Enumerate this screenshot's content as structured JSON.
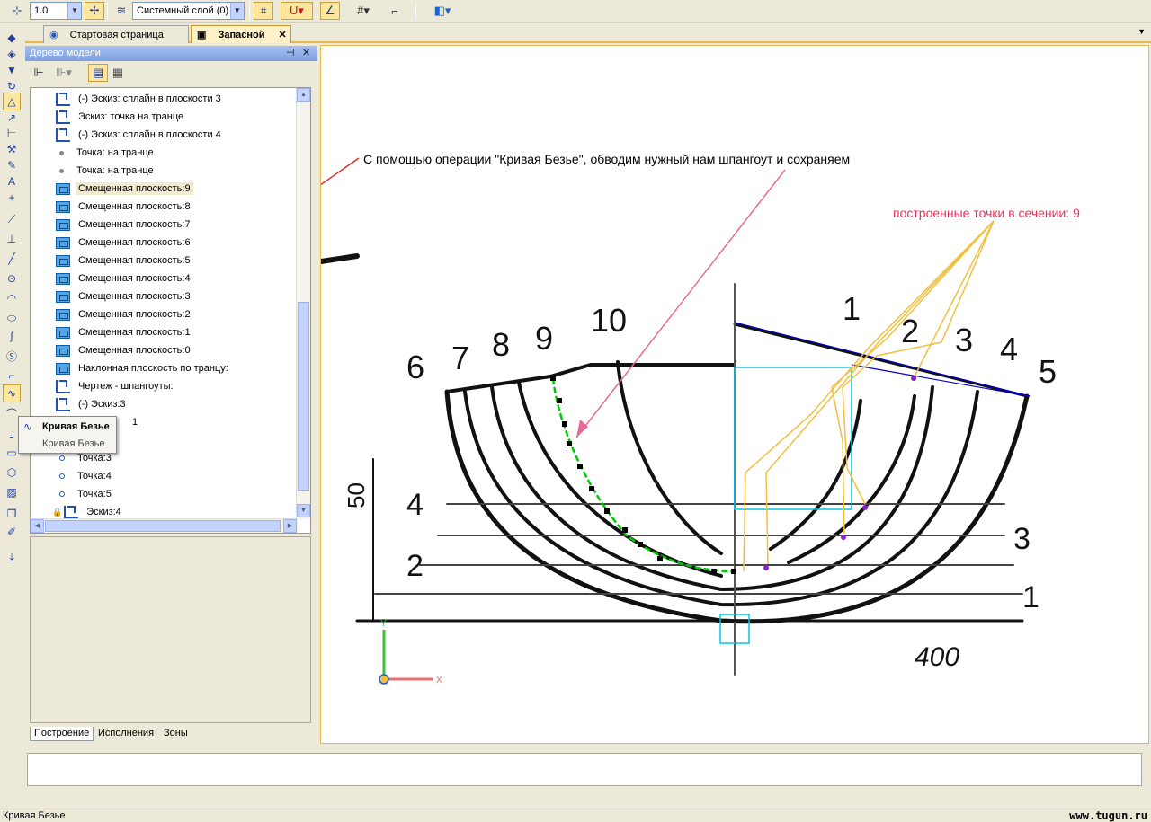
{
  "toolbar": {
    "scale_value": "1.0",
    "layer_value": "Системный слой (0)"
  },
  "tabs": [
    {
      "label": "Стартовая страница"
    },
    {
      "label": "Запасной"
    }
  ],
  "tree": {
    "title": "Дерево модели",
    "rows": [
      {
        "label": "(-) Эскиз: сплайн в плоскости 3",
        "icon": "sketch-icon"
      },
      {
        "label": "Эскиз: точка на транце",
        "icon": "sketch-icon"
      },
      {
        "label": "(-) Эскиз: сплайн  в плоскости 4",
        "icon": "sketch-icon"
      },
      {
        "label": "Точка: на транце",
        "icon": "point-icon"
      },
      {
        "label": "Точка: на транце",
        "icon": "point-icon"
      },
      {
        "label": "Смещенная плоскость:9",
        "icon": "plane-icon",
        "selected": true
      },
      {
        "label": "Смещенная плоскость:8",
        "icon": "plane-icon"
      },
      {
        "label": "Смещенная плоскость:7",
        "icon": "plane-icon"
      },
      {
        "label": "Смещенная плоскость:6",
        "icon": "plane-icon"
      },
      {
        "label": "Смещенная плоскость:5",
        "icon": "plane-icon"
      },
      {
        "label": "Смещенная плоскость:4",
        "icon": "plane-icon"
      },
      {
        "label": "Смещенная плоскость:3",
        "icon": "plane-icon"
      },
      {
        "label": "Смещенная плоскость:2",
        "icon": "plane-icon"
      },
      {
        "label": "Смещенная плоскость:1",
        "icon": "plane-icon"
      },
      {
        "label": "Смещенная плоскость:0",
        "icon": "plane-icon"
      },
      {
        "label": "Наклонная плоскость по транцу:",
        "icon": "plane-icon"
      },
      {
        "label": "Чертеж -  шпангоуты:",
        "icon": "sketch-icon"
      },
      {
        "label": "(-) Эскиз:3",
        "icon": "sketch-icon"
      },
      {
        "label": "1",
        "icon": "none"
      },
      {
        "label": "",
        "icon": "none"
      },
      {
        "label": "Точка:3",
        "icon": "point-blue-icon"
      },
      {
        "label": "Точка:4",
        "icon": "point-blue-icon"
      },
      {
        "label": "Точка:5",
        "icon": "point-blue-icon"
      },
      {
        "label": "Эскиз:4",
        "icon": "sketch-locked-icon"
      }
    ],
    "bottom_tabs": [
      "Построение",
      "Исполнения",
      "Зоны"
    ]
  },
  "tooltip": {
    "title": "Кривая Безье",
    "subtitle": "Кривая Безье"
  },
  "canvas": {
    "annotation_main": "С помощью операции \"Кривая Безье\", обводим нужный нам шпангоут и сохраняем",
    "annotation_points": "построенные точки в сечении: 9",
    "frame_numbers": [
      "6",
      "7",
      "8",
      "9",
      "10",
      "1",
      "2",
      "3",
      "4",
      "5"
    ],
    "waterline_labels": [
      "4",
      "2",
      "3",
      "1"
    ],
    "dimension_labels": [
      "50",
      "400"
    ],
    "axis_labels": [
      "Y",
      "X"
    ],
    "colors": {
      "bezier": "#00cc00",
      "arrow_pink": "#e86a9a",
      "arrow_red": "#e03030",
      "arrows_yellow": "#f0c040",
      "annotation_points": "#e8305a",
      "chord_line": "#0000cc",
      "cyan_box": "#00c8e0"
    }
  },
  "status": {
    "text": "Кривая Безье",
    "watermark": "www.tugun.ru"
  }
}
